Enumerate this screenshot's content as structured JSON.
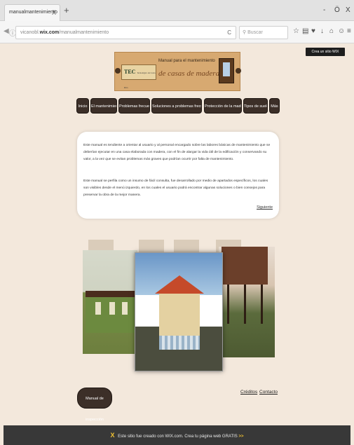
{
  "browser": {
    "tab_title": "manualmantenimiento",
    "tab_close": "X",
    "new_tab": "+",
    "url_prefix": "vicanobl",
    "url_domain": "wix.com",
    "url_path": "/manualmantenimiento",
    "reload_icon": "C",
    "search_placeholder": "Buscar",
    "win_minimize": "-",
    "win_maximize": "Ö",
    "win_close": "X"
  },
  "wix_banner": {
    "create_label": "Crea un sitio WIX"
  },
  "header": {
    "logo_text": "TEC",
    "logo_sub": "Tecnológico de Costa Rica",
    "subtitle": "Manual para el mantenimiento",
    "title": "de casas de madera"
  },
  "menu": {
    "items": [
      {
        "label": "Inicio"
      },
      {
        "label": "El mantenimiento"
      },
      {
        "label": "Problemas frecuentes"
      },
      {
        "label": "Soluciones a problemas frecuentes"
      },
      {
        "label": "Protección de la madera"
      },
      {
        "label": "Tipos de suelos"
      },
      {
        "label": "Más"
      }
    ]
  },
  "content": {
    "paragraph_1": "Este manual es tendiente a orientar al usuario y al personal encargado sobre las labores básicas de mantenimiento que se deberían ejecutar en una casa elaborada con madera, con el fin de alargar la vida útil de la edificación y conservando su valor, a la vez que se evitan problemas más graves que podrían ocurrir por falta de mantenimiento.",
    "paragraph_2": "Este manual se perfila como un insumo de fácil consulta, fue desarrollado por medio de apartados específicos, los cuales son visibles desde el menú izquierdo, en los cuales el usuario podrá encontrar algunas soluciones o bien consejos para preservar la obra de la mejor manera.",
    "next_link": "Siguiente"
  },
  "bottom": {
    "manual_button": "Manual de inspección",
    "credits_link": "Créditos",
    "contact_link": "Contacto"
  },
  "footer": {
    "logo_glyph": "X",
    "text": "Este sitio fue creado con WIX.com. Crea tu página web GRATIS",
    "arrows": ">>"
  },
  "colors": {
    "page_background": "#f3e8dc",
    "menu_button": "#3c2f28",
    "header_banner": "#d7a971",
    "footer_bar": "#383838",
    "wix_accent": "#f1c232"
  }
}
